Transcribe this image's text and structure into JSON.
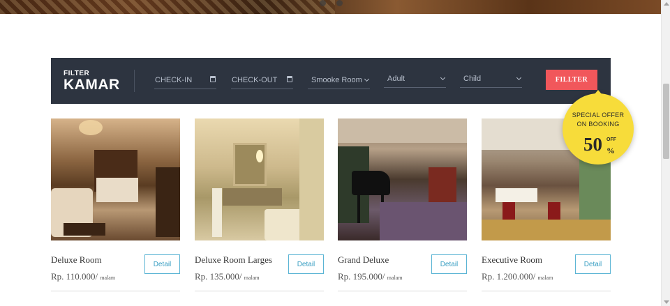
{
  "filter": {
    "title_small": "FILTER",
    "title_big": "KAMAR",
    "checkin_placeholder": "CHECK-IN",
    "checkout_placeholder": "CHECK-OUT",
    "smoke_value": "Smooke Room",
    "adult_value": "Adult",
    "child_value": "Child",
    "button_label": "FILLTER"
  },
  "offer": {
    "line1": "SPECIAL OFFER",
    "line2": "ON BOOKING",
    "percent": "50",
    "percent_sign": "%",
    "off": "OFF"
  },
  "rooms": [
    {
      "name": "Deluxe Room",
      "price": "Rp. 110.000/",
      "unit": "malam",
      "button": "Detail"
    },
    {
      "name": "Deluxe Room Larges",
      "price": "Rp. 135.000/",
      "unit": "malam",
      "button": "Detail"
    },
    {
      "name": "Grand Deluxe",
      "price": "Rp. 195.000/",
      "unit": "malam",
      "button": "Detail"
    },
    {
      "name": "Executive Room",
      "price": "Rp. 1.200.000/",
      "unit": "malam",
      "button": "Detail"
    }
  ],
  "colors": {
    "filter_bg": "#2d3440",
    "button_red": "#f1575b",
    "offer_yellow": "#f7dc3a",
    "detail_blue": "#5ab4d4"
  }
}
